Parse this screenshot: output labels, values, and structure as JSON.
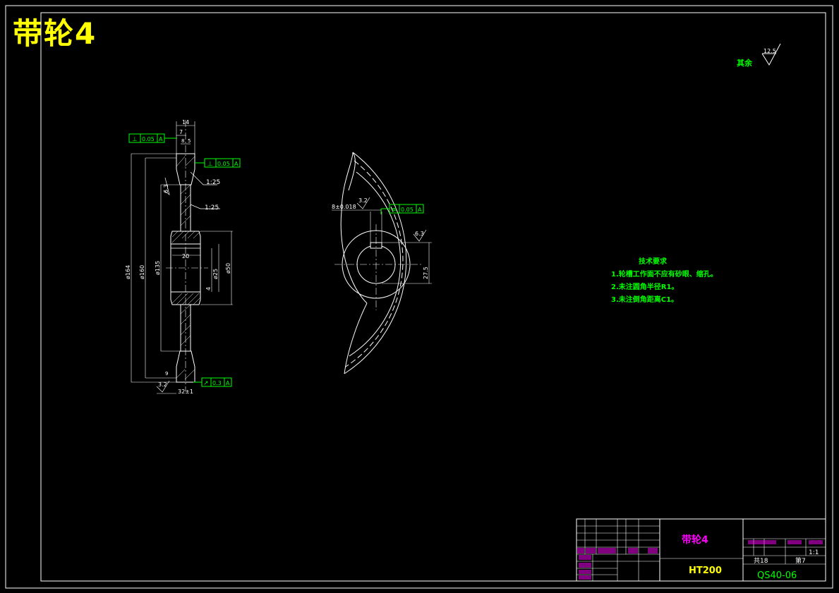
{
  "drawing": {
    "big_title": "带轮4",
    "roughness_note": {
      "label": "其余",
      "value": "12.5"
    },
    "tech_requirements": {
      "heading": "技术要求",
      "items": [
        "1.轮槽工作面不应有砂眼、缩孔。",
        "2.未注圆角半径R1。",
        "3.未注倒角距离C1。"
      ]
    },
    "section_view": {
      "dims": {
        "width_total": "14",
        "groove_7": "7",
        "groove_8": "8",
        "groove_5": "5",
        "hub_20": "20",
        "d_outer": "ø164",
        "d_pitch": "ø160",
        "d_135": "ø135",
        "d_bore": "ø25",
        "d_hub": "ø50",
        "d_4": "4",
        "d_32": "32±1",
        "d_9": "9",
        "taper1": "1:25",
        "taper2": "1:25",
        "rough_63": "6.3",
        "rough_32": "3.2"
      },
      "tolerances": [
        {
          "sym": "⊥",
          "val": "0.05",
          "ref": "A"
        },
        {
          "sym": "⊥",
          "val": "0.05",
          "ref": "A"
        },
        {
          "sym": "↗",
          "val": "0.3",
          "ref": "A"
        }
      ]
    },
    "front_view": {
      "dims": {
        "keyway": "8±0.018",
        "rough_32": "3.2",
        "rough_63": "6.3",
        "key_depth": "27.5"
      },
      "tolerance": {
        "sym": "≡",
        "val": "0.05",
        "ref": "A"
      }
    },
    "title_block": {
      "part_name": "带轮4",
      "material": "HT200",
      "drawing_no": "QS40-06",
      "scale": "1:1",
      "sheet_info": "共18张 第7张",
      "sheets_total": "共18",
      "sheet_no": "第7"
    }
  }
}
